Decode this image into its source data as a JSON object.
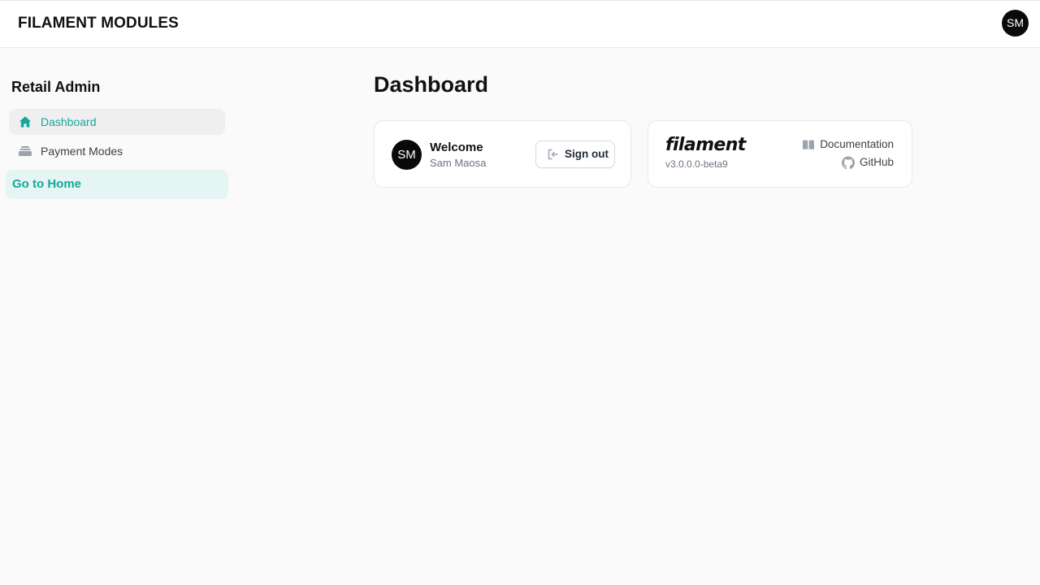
{
  "topbar": {
    "brand": "FILAMENT MODULES",
    "avatar_initials": "SM"
  },
  "sidebar": {
    "title": "Retail Admin",
    "items": [
      {
        "label": "Dashboard",
        "icon": "home-icon",
        "active": true
      },
      {
        "label": "Payment Modes",
        "icon": "payment-modes-icon",
        "active": false
      }
    ],
    "go_home_label": "Go to Home"
  },
  "main": {
    "page_title": "Dashboard",
    "welcome_card": {
      "avatar_initials": "SM",
      "heading": "Welcome",
      "user_name": "Sam Maosa",
      "signout_label": "Sign out"
    },
    "filament_card": {
      "logo_text": "filament",
      "version": "v3.0.0.0-beta9",
      "docs_label": "Documentation",
      "github_label": "GitHub"
    }
  },
  "colors": {
    "accent": "#14a89a",
    "accent_bg": "#e5f5f3",
    "page_bg": "#fafafa",
    "avatar_bg": "#0a0a0a"
  }
}
